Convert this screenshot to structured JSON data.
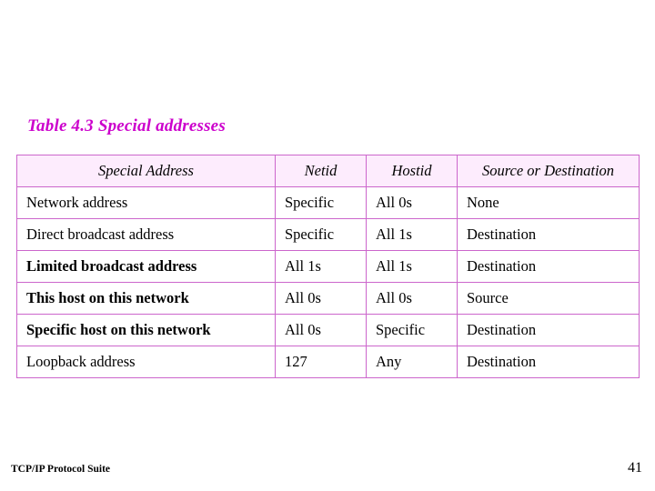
{
  "slide": {
    "title": "Table 4.3  Special addresses",
    "footer_left": "TCP/IP Protocol Suite",
    "page_number": "41",
    "accent_color": "#cc00cc",
    "border_color": "#cc66cc",
    "header_fill": "#fdecfd"
  },
  "table": {
    "headers": [
      "Special Address",
      "Netid",
      "Hostid",
      "Source or Destination"
    ],
    "rows": [
      {
        "address": "Network address",
        "netid": "Specific",
        "hostid": "All 0s",
        "source_or_destination": "None",
        "bold": false
      },
      {
        "address": "Direct broadcast address",
        "netid": "Specific",
        "hostid": "All 1s",
        "source_or_destination": "Destination",
        "bold": false
      },
      {
        "address": "Limited broadcast address",
        "netid": "All 1s",
        "hostid": "All 1s",
        "source_or_destination": "Destination",
        "bold": true
      },
      {
        "address": "This host on this network",
        "netid": "All 0s",
        "hostid": "All 0s",
        "source_or_destination": "Source",
        "bold": true
      },
      {
        "address": "Specific host on this network",
        "netid": "All 0s",
        "hostid": "Specific",
        "source_or_destination": "Destination",
        "bold": true
      },
      {
        "address": "Loopback address",
        "netid": "127",
        "hostid": "Any",
        "source_or_destination": "Destination",
        "bold": false
      }
    ]
  }
}
